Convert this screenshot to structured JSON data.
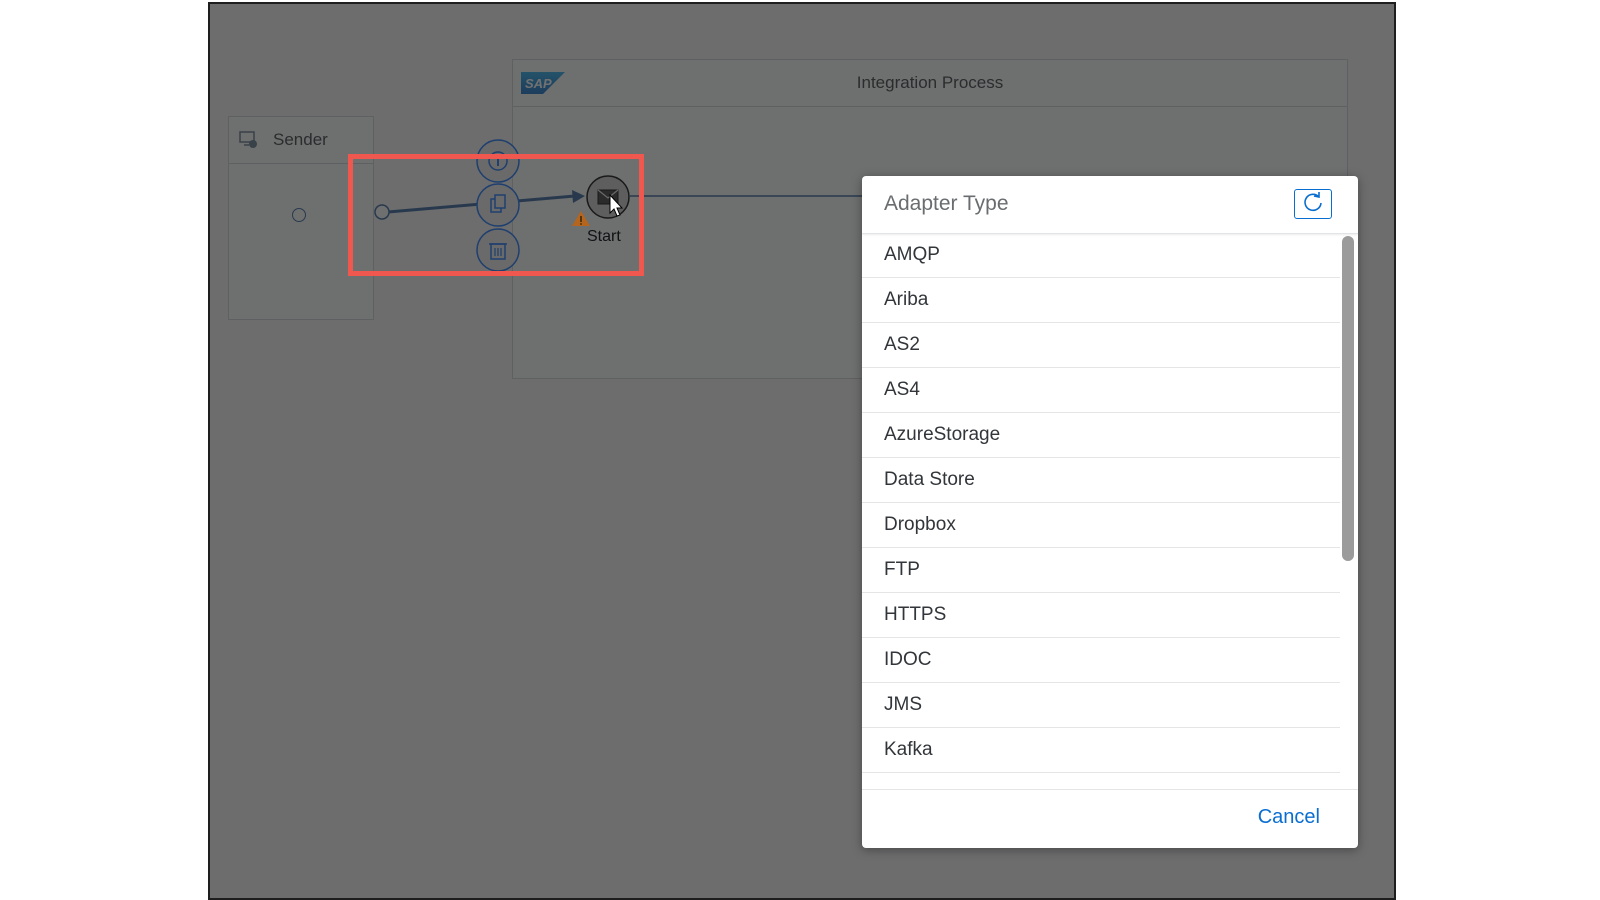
{
  "diagram": {
    "sender_title": "Sender",
    "process_title": "Integration Process",
    "sap_logo_text": "SAP",
    "start_label": "Start",
    "icons": {
      "sender": "sender-system-icon",
      "info": "info-icon",
      "copy": "copy-icon",
      "delete": "trash-icon",
      "start_event": "start-message-event-icon",
      "warning": "warning-icon",
      "cursor": "mouse-pointer-icon"
    },
    "colors": {
      "highlight": "#f0584f",
      "flow_line": "#2b5d98",
      "warning": "#e9730c"
    }
  },
  "dialog": {
    "title": "Adapter Type",
    "refresh_icon": "refresh-icon",
    "items": [
      {
        "label": "AMQP"
      },
      {
        "label": "Ariba"
      },
      {
        "label": "AS2"
      },
      {
        "label": "AS4"
      },
      {
        "label": "AzureStorage"
      },
      {
        "label": "Data Store"
      },
      {
        "label": "Dropbox"
      },
      {
        "label": "FTP"
      },
      {
        "label": "HTTPS"
      },
      {
        "label": "IDOC"
      },
      {
        "label": "JMS"
      },
      {
        "label": "Kafka"
      }
    ],
    "cancel_label": "Cancel",
    "accent_color": "#0a6ed1"
  }
}
